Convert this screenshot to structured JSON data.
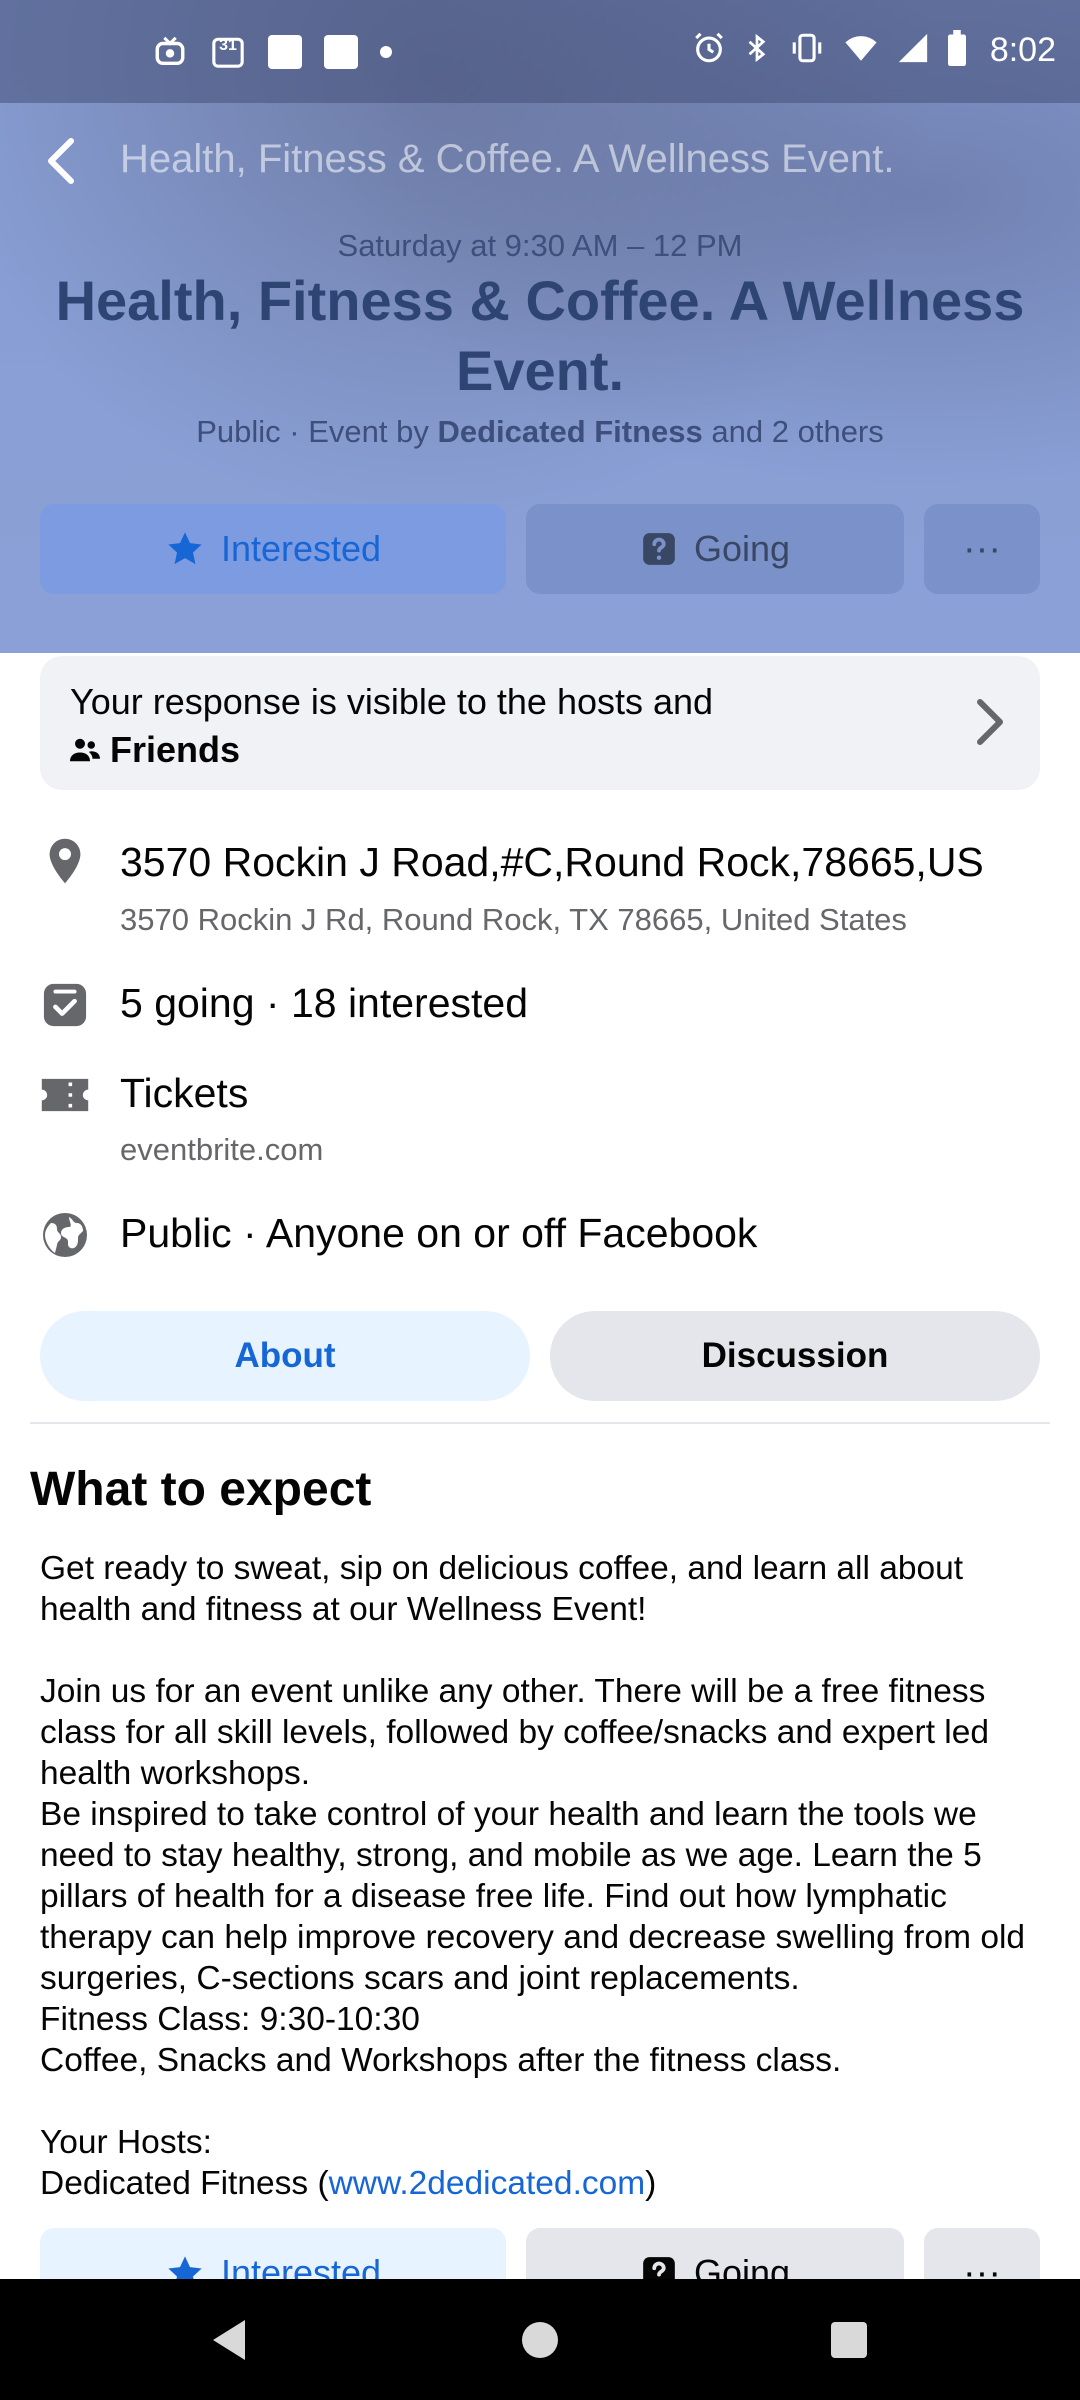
{
  "status_bar": {
    "time": "8:02",
    "calendar_day": "31",
    "icons_left": [
      "tv-icon",
      "calendar-icon",
      "notification-square-icon",
      "notification-square-icon",
      "dot-icon"
    ],
    "icons_right": [
      "alarm-icon",
      "bluetooth-icon",
      "vibrate-icon",
      "wifi-icon",
      "signal-icon",
      "battery-icon"
    ]
  },
  "topbar": {
    "title": "Health, Fitness & Coffee. A Wellness Event."
  },
  "event": {
    "date_time": "Saturday at 9:30 AM – 12 PM",
    "title": "Health, Fitness & Coffee. A Wellness Event.",
    "meta_prefix": "Public · Event by",
    "host": "Dedicated Fitness",
    "meta_suffix": "and 2 others"
  },
  "actions": {
    "interested_label": "Interested",
    "going_label": "Going",
    "more_label": "···"
  },
  "response_card": {
    "text": "Your response is visible to the hosts and",
    "audience": "Friends"
  },
  "info": {
    "address_main": "3570 Rockin J Road,#C,Round Rock,78665,US",
    "address_sub": "3570 Rockin J Rd, Round Rock, TX 78665, United States",
    "attendance": "5 going · 18 interested",
    "tickets_label": "Tickets",
    "tickets_site": "eventbrite.com",
    "privacy": "Public · Anyone on or off Facebook"
  },
  "tabs": {
    "about": "About",
    "discussion": "Discussion"
  },
  "details": {
    "heading": "What to expect",
    "para1": "Get ready to sweat, sip on delicious coffee, and learn all about health and fitness at our Wellness Event!",
    "para2": "Join us for an event unlike any other. There will be a free fitness class for all skill levels, followed by coffee/snacks and expert led health workshops.",
    "para3": "Be inspired to take control of your health and learn the tools we need to stay healthy, strong, and mobile as we age. Learn the 5 pillars of health for a disease free life. Find out how lymphatic therapy can help improve recovery and decrease swelling from old surgeries, C-sections scars and joint replacements.",
    "para4": "Fitness Class: 9:30-10:30",
    "para5": "Coffee, Snacks and Workshops after the fitness class.",
    "hosts_label": "Your Hosts:",
    "host_name": "Dedicated Fitness (",
    "host_link": "www.2dedicated.com",
    "host_close": ")"
  },
  "colors": {
    "accent": "#1766d6",
    "header_bg": "#8ba1d6",
    "title_color": "#2e4574"
  }
}
